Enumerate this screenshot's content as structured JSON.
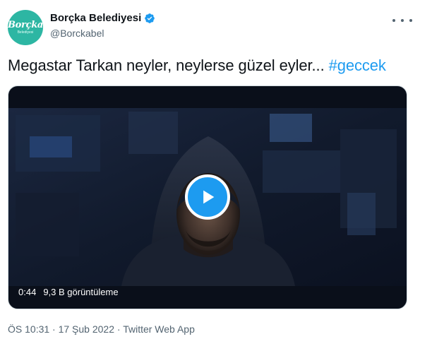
{
  "author": {
    "display_name": "Borçka Belediyesi",
    "handle": "@Borckabel",
    "verified": true,
    "avatar_text": "Borçka",
    "avatar_subtext": "Belediyesi"
  },
  "tweet": {
    "text_main": "Megastar Tarkan neyler, neylerse güzel eyler...",
    "hashtag": "#geccek"
  },
  "video": {
    "duration": "0:44",
    "views": "9,3 B görüntüleme"
  },
  "footer": {
    "timestamp": "ÖS 10:31 · 17 Şub 2022 · Twitter Web App"
  },
  "colors": {
    "accent": "#1d9bf0",
    "avatar_bg": "#2db6a3",
    "secondary_text": "#536471"
  }
}
